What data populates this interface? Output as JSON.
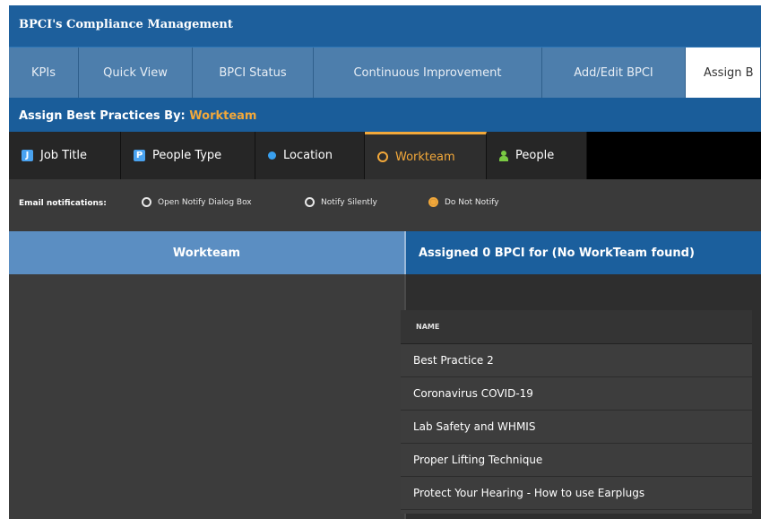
{
  "app": {
    "title": "BPCI's Compliance Management"
  },
  "nav_tabs": [
    {
      "label": "KPIs"
    },
    {
      "label": "Quick View"
    },
    {
      "label": "BPCI Status"
    },
    {
      "label": "Continuous Improvement"
    },
    {
      "label": "Add/Edit BPCI"
    },
    {
      "label": "Assign B"
    }
  ],
  "assign_header": {
    "label": "Assign Best Practices By: ",
    "value": "Workteam"
  },
  "assign_tabs": [
    {
      "label": "Job Title",
      "icon": "job-title-icon",
      "glyph": "J"
    },
    {
      "label": "People Type",
      "icon": "people-type-icon",
      "glyph": "P"
    },
    {
      "label": "Location",
      "icon": "location-icon"
    },
    {
      "label": "Workteam",
      "icon": "workteam-icon"
    },
    {
      "label": "People",
      "icon": "person-icon"
    }
  ],
  "email": {
    "label": "Email notifications:",
    "options": [
      {
        "label": "Open Notify Dialog Box",
        "selected": false
      },
      {
        "label": "Notify Silently",
        "selected": false
      },
      {
        "label": "Do Not Notify",
        "selected": true
      }
    ]
  },
  "left_panel": {
    "header": "Workteam"
  },
  "right_panel": {
    "header": "Assigned 0 BPCI for (No WorkTeam found)"
  },
  "grid": {
    "column": "NAME",
    "rows": [
      "Best Practice 2",
      "Coronavirus COVID-19",
      "Lab Safety and WHMIS",
      "Proper Lifting Technique",
      "Protect Your Hearing - How to use Earplugs"
    ]
  },
  "colors": {
    "accent": "#f2a83a",
    "brand_blue": "#1d5f9c",
    "panel_blue": "#5b8ec2"
  }
}
